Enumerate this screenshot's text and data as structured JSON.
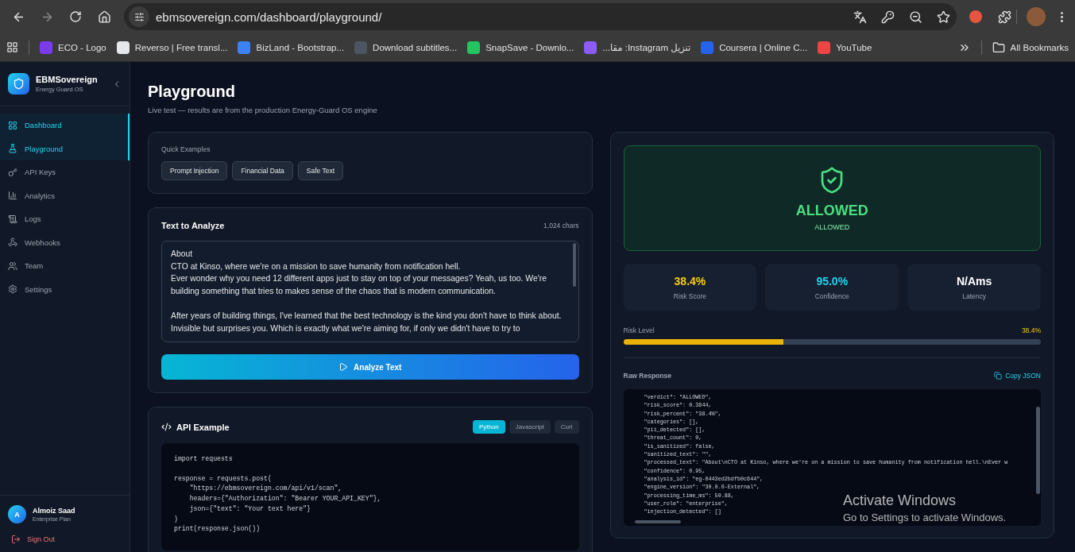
{
  "browser": {
    "url": "ebmsovereign.com/dashboard/playground/",
    "bookmarks": [
      {
        "label": "ECO - Logo",
        "color": "#7c3aed"
      },
      {
        "label": "Reverso | Free transl...",
        "color": "#e5e7eb"
      },
      {
        "label": "BizLand - Bootstrap...",
        "color": "#3b82f6"
      },
      {
        "label": "Download subtitles...",
        "color": "#4b5563"
      },
      {
        "label": "SnapSave - Downlo...",
        "color": "#22c55e"
      },
      {
        "label": "تنزيل Instagram: مقا...",
        "color": "#8b5cf6"
      },
      {
        "label": "Coursera | Online C...",
        "color": "#2563eb"
      },
      {
        "label": "YouTube",
        "color": "#ef4444"
      }
    ],
    "all_bookmarks": "All Bookmarks"
  },
  "sidebar": {
    "brand": "EBMSovereign",
    "tagline": "Energy Guard OS",
    "items": [
      {
        "label": "Dashboard",
        "selected": true
      },
      {
        "label": "Playground",
        "selected": true
      },
      {
        "label": "API Keys",
        "selected": false
      },
      {
        "label": "Analytics",
        "selected": false
      },
      {
        "label": "Logs",
        "selected": false
      },
      {
        "label": "Webhooks",
        "selected": false
      },
      {
        "label": "Team",
        "selected": false
      },
      {
        "label": "Settings",
        "selected": false
      }
    ],
    "user": {
      "initial": "A",
      "name": "Almoiz Saad",
      "plan": "Enterprise Plan"
    },
    "sign_out": "Sign Out"
  },
  "page": {
    "title": "Playground",
    "subtitle": "Live test — results are from the production Energy-Guard OS engine"
  },
  "quick_examples": {
    "label": "Quick Examples",
    "buttons": [
      "Prompt Injection",
      "Financial Data",
      "Safe Text"
    ]
  },
  "analyze": {
    "title": "Text to Analyze",
    "count": "1,024 chars",
    "value": "About\nCTO at Kinso, where we're on a mission to save humanity from notification hell.\nEver wonder why you need 12 different apps just to stay on top of your messages? Yeah, us too. We're building something that tries to makes sense of the chaos that is modern communication.\n\nAfter years of building things, I've learned that the best technology is the kind you don't have to think about. Invisible but surprises you. Which is exactly what we're aiming for, if only we didn't have to try to",
    "button": "Analyze Text"
  },
  "api_example": {
    "title": "API Example",
    "tabs": [
      {
        "label": "Python",
        "selected": true
      },
      {
        "label": "Javascript",
        "selected": false
      },
      {
        "label": "Curl",
        "selected": false
      }
    ],
    "code": [
      [
        "import requests"
      ],
      [
        "response = requests.post(",
        "    \"https://ebmsovereign.com/api/v1/scan\",",
        "    headers={\"Authorization\": \"Bearer YOUR_API_KEY\"},",
        "    json={\"text\": \"Your text here\"}",
        ")",
        "print(response.json())"
      ]
    ]
  },
  "result": {
    "verdict": "ALLOWED",
    "verdict_sub": "ALLOWED",
    "stats": [
      {
        "value": "38.4%",
        "label": "Risk Score",
        "color": "#facc15"
      },
      {
        "value": "95.0%",
        "label": "Confidence",
        "color": "#22d3ee"
      },
      {
        "value": "N/Ams",
        "label": "Latency",
        "color": "#ffffff"
      }
    ],
    "risk": {
      "label": "Risk Level",
      "reading": "38.4%",
      "level": 0.384
    },
    "raw": {
      "title": "Raw Response",
      "copy": "Copy JSON",
      "lines": [
        "\"verdict\": \"ALLOWED\",",
        "\"risk_score\": 0.3844,",
        "\"risk_percent\": \"38.4%\",",
        "\"categories\": [],",
        "\"pii_detected\": [],",
        "\"threat_count\": 0,",
        "\"is_sanitized\": false,",
        "\"sanitized_text\": \"\",",
        "\"processed_text\": \"About\\nCTO at Kinso, where we're on a mission to save humanity from notification hell.\\nEver w",
        "\"confidence\": 0.95,",
        "\"analysis_id\": \"eg-0443ed2bdfb0c644\",",
        "\"engine_version\": \"30.0.0-External\",",
        "\"processing_time_ms\": 50.88,",
        "\"user_role\": \"enterprise\",",
        "\"injection_detected\": []"
      ]
    }
  },
  "os_overlay": {
    "title": "Activate Windows",
    "subtitle": "Go to Settings to activate Windows."
  }
}
